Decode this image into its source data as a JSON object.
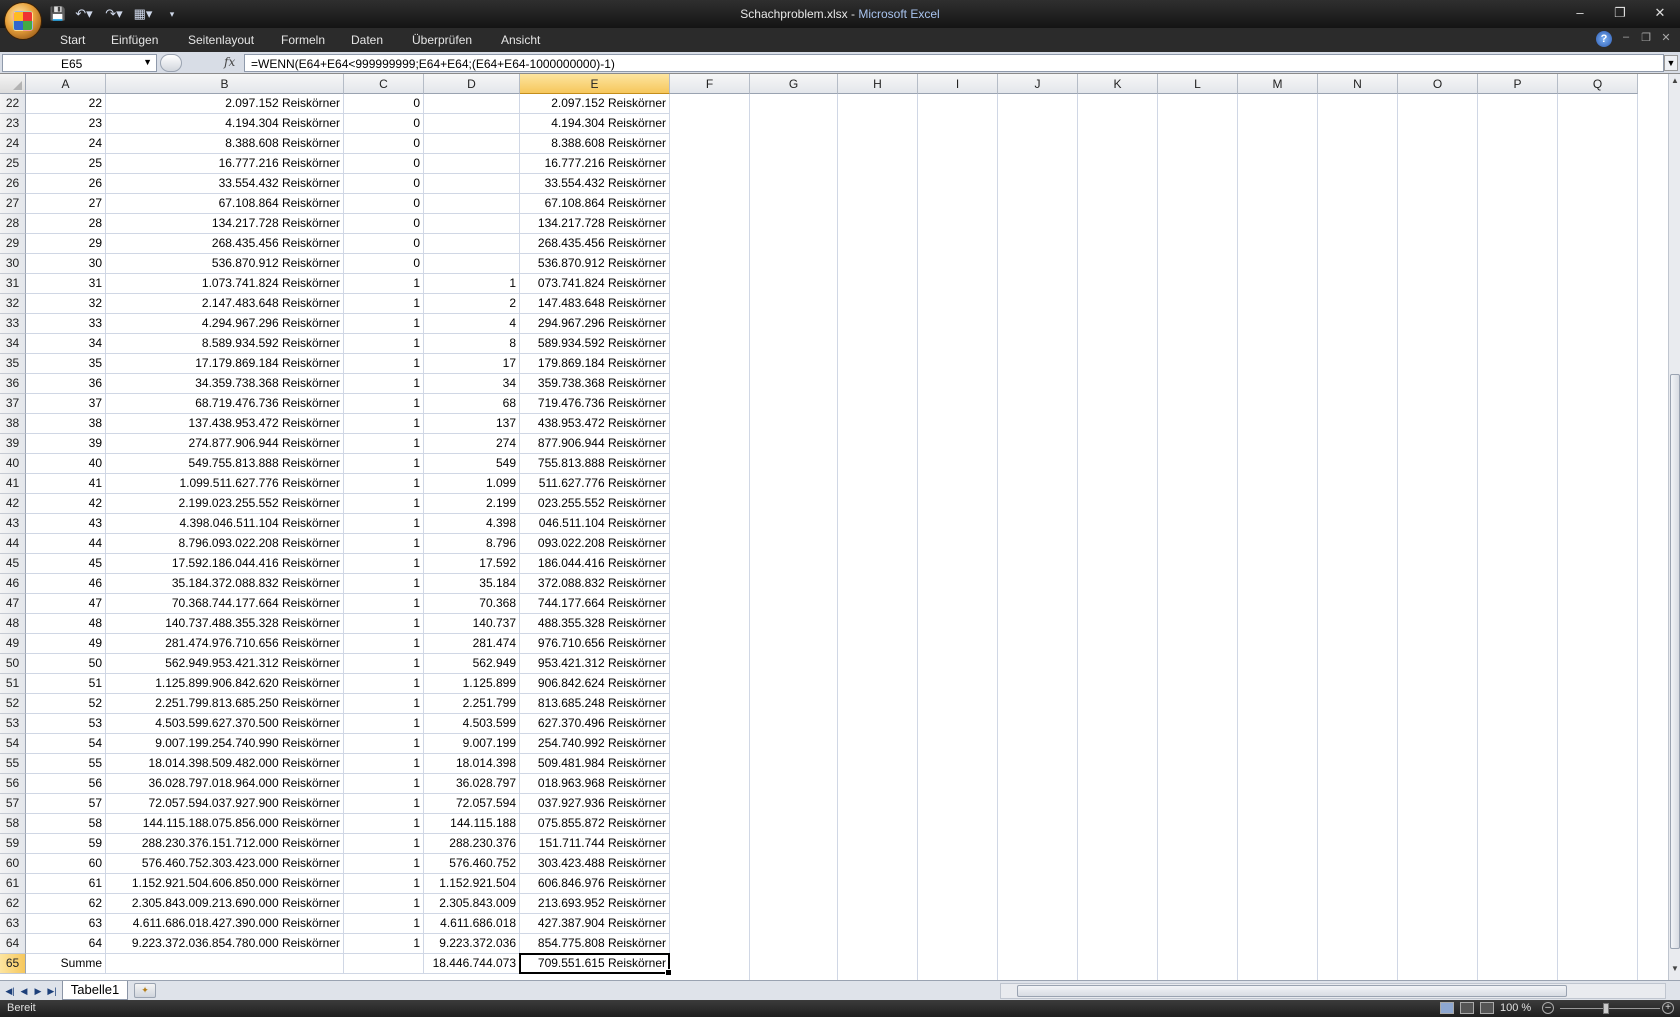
{
  "window": {
    "title_file": "Schachproblem.xlsx",
    "title_sep": " - ",
    "title_app": "Microsoft Excel"
  },
  "ribbon": {
    "tabs": [
      "Start",
      "Einfügen",
      "Seitenlayout",
      "Formeln",
      "Daten",
      "Überprüfen",
      "Ansicht"
    ]
  },
  "formula_bar": {
    "name_box": "E65",
    "fx_label": "fx",
    "formula": "=WENN(E64+E64<999999999;E64+E64;(E64+E64-1000000000)-1)"
  },
  "columns": [
    "A",
    "B",
    "C",
    "D",
    "E",
    "F",
    "G",
    "H",
    "I",
    "J",
    "K",
    "L",
    "M",
    "N",
    "O",
    "P",
    "Q"
  ],
  "selected_column": "E",
  "rows": [
    {
      "row": "22",
      "a": "22",
      "b": "2.097.152 Reiskörner",
      "c": "0",
      "d": "",
      "e": "2.097.152 Reiskörner"
    },
    {
      "row": "23",
      "a": "23",
      "b": "4.194.304 Reiskörner",
      "c": "0",
      "d": "",
      "e": "4.194.304 Reiskörner"
    },
    {
      "row": "24",
      "a": "24",
      "b": "8.388.608 Reiskörner",
      "c": "0",
      "d": "",
      "e": "8.388.608 Reiskörner"
    },
    {
      "row": "25",
      "a": "25",
      "b": "16.777.216 Reiskörner",
      "c": "0",
      "d": "",
      "e": "16.777.216 Reiskörner"
    },
    {
      "row": "26",
      "a": "26",
      "b": "33.554.432 Reiskörner",
      "c": "0",
      "d": "",
      "e": "33.554.432 Reiskörner"
    },
    {
      "row": "27",
      "a": "27",
      "b": "67.108.864 Reiskörner",
      "c": "0",
      "d": "",
      "e": "67.108.864 Reiskörner"
    },
    {
      "row": "28",
      "a": "28",
      "b": "134.217.728 Reiskörner",
      "c": "0",
      "d": "",
      "e": "134.217.728 Reiskörner"
    },
    {
      "row": "29",
      "a": "29",
      "b": "268.435.456 Reiskörner",
      "c": "0",
      "d": "",
      "e": "268.435.456 Reiskörner"
    },
    {
      "row": "30",
      "a": "30",
      "b": "536.870.912 Reiskörner",
      "c": "0",
      "d": "",
      "e": "536.870.912 Reiskörner"
    },
    {
      "row": "31",
      "a": "31",
      "b": "1.073.741.824 Reiskörner",
      "c": "1",
      "d": "1",
      "e": "073.741.824 Reiskörner"
    },
    {
      "row": "32",
      "a": "32",
      "b": "2.147.483.648 Reiskörner",
      "c": "1",
      "d": "2",
      "e": "147.483.648 Reiskörner"
    },
    {
      "row": "33",
      "a": "33",
      "b": "4.294.967.296 Reiskörner",
      "c": "1",
      "d": "4",
      "e": "294.967.296 Reiskörner"
    },
    {
      "row": "34",
      "a": "34",
      "b": "8.589.934.592 Reiskörner",
      "c": "1",
      "d": "8",
      "e": "589.934.592 Reiskörner"
    },
    {
      "row": "35",
      "a": "35",
      "b": "17.179.869.184 Reiskörner",
      "c": "1",
      "d": "17",
      "e": "179.869.184 Reiskörner"
    },
    {
      "row": "36",
      "a": "36",
      "b": "34.359.738.368 Reiskörner",
      "c": "1",
      "d": "34",
      "e": "359.738.368 Reiskörner"
    },
    {
      "row": "37",
      "a": "37",
      "b": "68.719.476.736 Reiskörner",
      "c": "1",
      "d": "68",
      "e": "719.476.736 Reiskörner"
    },
    {
      "row": "38",
      "a": "38",
      "b": "137.438.953.472 Reiskörner",
      "c": "1",
      "d": "137",
      "e": "438.953.472 Reiskörner"
    },
    {
      "row": "39",
      "a": "39",
      "b": "274.877.906.944 Reiskörner",
      "c": "1",
      "d": "274",
      "e": "877.906.944 Reiskörner"
    },
    {
      "row": "40",
      "a": "40",
      "b": "549.755.813.888 Reiskörner",
      "c": "1",
      "d": "549",
      "e": "755.813.888 Reiskörner"
    },
    {
      "row": "41",
      "a": "41",
      "b": "1.099.511.627.776 Reiskörner",
      "c": "1",
      "d": "1.099",
      "e": "511.627.776 Reiskörner"
    },
    {
      "row": "42",
      "a": "42",
      "b": "2.199.023.255.552 Reiskörner",
      "c": "1",
      "d": "2.199",
      "e": "023.255.552 Reiskörner"
    },
    {
      "row": "43",
      "a": "43",
      "b": "4.398.046.511.104 Reiskörner",
      "c": "1",
      "d": "4.398",
      "e": "046.511.104 Reiskörner"
    },
    {
      "row": "44",
      "a": "44",
      "b": "8.796.093.022.208 Reiskörner",
      "c": "1",
      "d": "8.796",
      "e": "093.022.208 Reiskörner"
    },
    {
      "row": "45",
      "a": "45",
      "b": "17.592.186.044.416 Reiskörner",
      "c": "1",
      "d": "17.592",
      "e": "186.044.416 Reiskörner"
    },
    {
      "row": "46",
      "a": "46",
      "b": "35.184.372.088.832 Reiskörner",
      "c": "1",
      "d": "35.184",
      "e": "372.088.832 Reiskörner"
    },
    {
      "row": "47",
      "a": "47",
      "b": "70.368.744.177.664 Reiskörner",
      "c": "1",
      "d": "70.368",
      "e": "744.177.664 Reiskörner"
    },
    {
      "row": "48",
      "a": "48",
      "b": "140.737.488.355.328 Reiskörner",
      "c": "1",
      "d": "140.737",
      "e": "488.355.328 Reiskörner"
    },
    {
      "row": "49",
      "a": "49",
      "b": "281.474.976.710.656 Reiskörner",
      "c": "1",
      "d": "281.474",
      "e": "976.710.656 Reiskörner"
    },
    {
      "row": "50",
      "a": "50",
      "b": "562.949.953.421.312 Reiskörner",
      "c": "1",
      "d": "562.949",
      "e": "953.421.312 Reiskörner"
    },
    {
      "row": "51",
      "a": "51",
      "b": "1.125.899.906.842.620 Reiskörner",
      "c": "1",
      "d": "1.125.899",
      "e": "906.842.624 Reiskörner"
    },
    {
      "row": "52",
      "a": "52",
      "b": "2.251.799.813.685.250 Reiskörner",
      "c": "1",
      "d": "2.251.799",
      "e": "813.685.248 Reiskörner"
    },
    {
      "row": "53",
      "a": "53",
      "b": "4.503.599.627.370.500 Reiskörner",
      "c": "1",
      "d": "4.503.599",
      "e": "627.370.496 Reiskörner"
    },
    {
      "row": "54",
      "a": "54",
      "b": "9.007.199.254.740.990 Reiskörner",
      "c": "1",
      "d": "9.007.199",
      "e": "254.740.992 Reiskörner"
    },
    {
      "row": "55",
      "a": "55",
      "b": "18.014.398.509.482.000 Reiskörner",
      "c": "1",
      "d": "18.014.398",
      "e": "509.481.984 Reiskörner"
    },
    {
      "row": "56",
      "a": "56",
      "b": "36.028.797.018.964.000 Reiskörner",
      "c": "1",
      "d": "36.028.797",
      "e": "018.963.968 Reiskörner"
    },
    {
      "row": "57",
      "a": "57",
      "b": "72.057.594.037.927.900 Reiskörner",
      "c": "1",
      "d": "72.057.594",
      "e": "037.927.936 Reiskörner"
    },
    {
      "row": "58",
      "a": "58",
      "b": "144.115.188.075.856.000 Reiskörner",
      "c": "1",
      "d": "144.115.188",
      "e": "075.855.872 Reiskörner"
    },
    {
      "row": "59",
      "a": "59",
      "b": "288.230.376.151.712.000 Reiskörner",
      "c": "1",
      "d": "288.230.376",
      "e": "151.711.744 Reiskörner"
    },
    {
      "row": "60",
      "a": "60",
      "b": "576.460.752.303.423.000 Reiskörner",
      "c": "1",
      "d": "576.460.752",
      "e": "303.423.488 Reiskörner"
    },
    {
      "row": "61",
      "a": "61",
      "b": "1.152.921.504.606.850.000 Reiskörner",
      "c": "1",
      "d": "1.152.921.504",
      "e": "606.846.976 Reiskörner"
    },
    {
      "row": "62",
      "a": "62",
      "b": "2.305.843.009.213.690.000 Reiskörner",
      "c": "1",
      "d": "2.305.843.009",
      "e": "213.693.952 Reiskörner"
    },
    {
      "row": "63",
      "a": "63",
      "b": "4.611.686.018.427.390.000 Reiskörner",
      "c": "1",
      "d": "4.611.686.018",
      "e": "427.387.904 Reiskörner"
    },
    {
      "row": "64",
      "a": "64",
      "b": "9.223.372.036.854.780.000 Reiskörner",
      "c": "1",
      "d": "9.223.372.036",
      "e": "854.775.808 Reiskörner"
    },
    {
      "row": "65",
      "a": "Summe",
      "b": "",
      "c": "",
      "d": "18.446.744.073",
      "e": "709.551.615 Reiskörner"
    }
  ],
  "selected_row": "65",
  "sheet_tabs": [
    "Tabelle1"
  ],
  "status": {
    "text": "Bereit",
    "zoom": "100 %"
  }
}
